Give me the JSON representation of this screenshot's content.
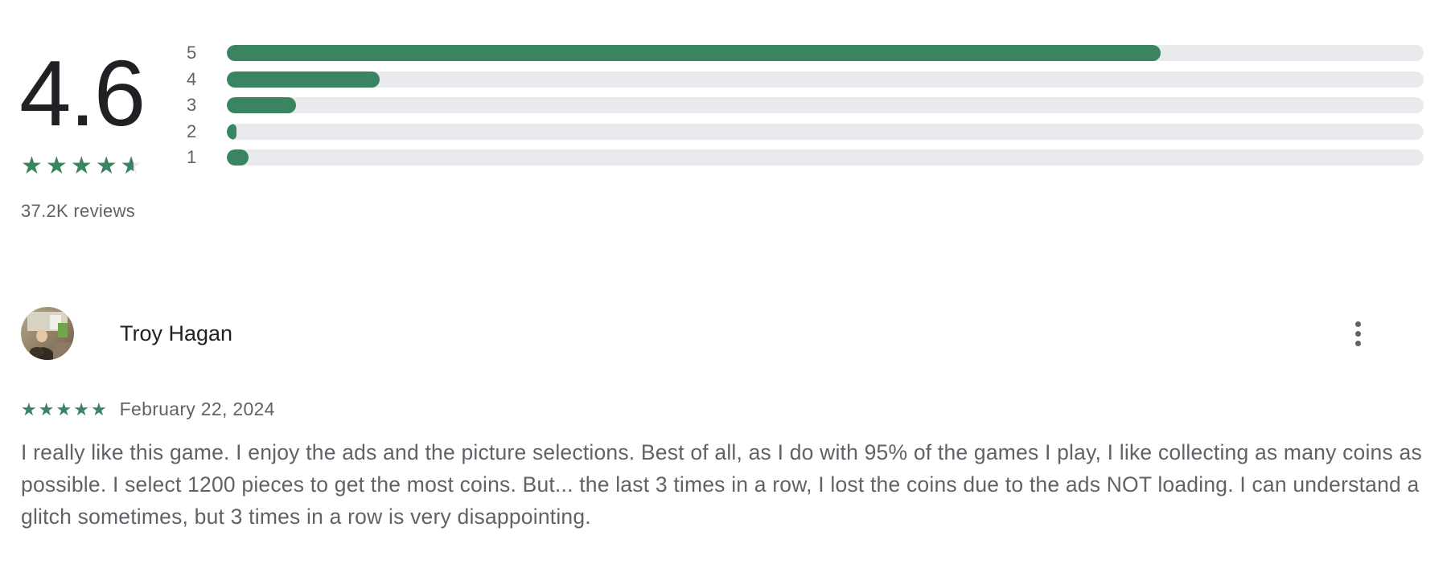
{
  "rating_summary": {
    "score": "4.6",
    "stars_value": 4.6,
    "reviews_label": "37.2K reviews",
    "accent_color": "#3b8462",
    "track_color": "#e8eaed",
    "distribution": [
      {
        "label": "5",
        "fraction": 0.78
      },
      {
        "label": "4",
        "fraction": 0.128
      },
      {
        "label": "3",
        "fraction": 0.058
      },
      {
        "label": "2",
        "fraction": 0.007
      },
      {
        "label": "1",
        "fraction": 0.018
      }
    ]
  },
  "review": {
    "author": "Troy Hagan",
    "avatar_icon": "user-photo-avatar",
    "more_icon": "more-vertical-icon",
    "rating": 5,
    "date": "February 22, 2024",
    "text": "I really like this game. I enjoy the ads and the picture selections. Best of all, as I do with 95% of the games I play, I like collecting as many coins as possible. I select 1200 pieces to get the most coins. But... the last 3 times in a row, I lost the coins due to the ads NOT loading. I can understand a glitch sometimes, but 3 times in a row is very disappointing."
  }
}
